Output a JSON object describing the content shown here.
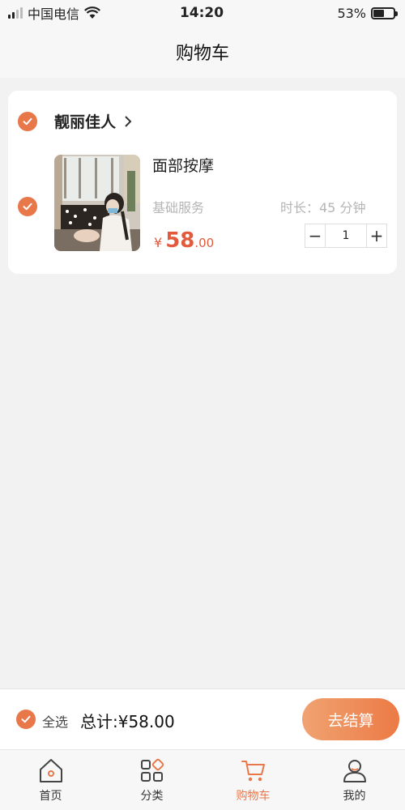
{
  "status_bar": {
    "carrier": "中国电信",
    "time": "14:20",
    "battery_percent": "53%",
    "battery_level": 0.53
  },
  "nav": {
    "title": "购物车"
  },
  "cart": {
    "shop_name": "靓丽佳人",
    "item": {
      "name": "面部按摩",
      "type": "基础服务",
      "duration": "时长：45 分钟",
      "currency": "¥",
      "price_int": "58",
      "price_dec": ".00",
      "quantity": "1",
      "decrease_label": "−",
      "increase_label": "+"
    }
  },
  "checkout": {
    "select_all": "全选",
    "total": "总计:¥58.00",
    "button": "去结算"
  },
  "tabs": [
    {
      "label": "首页",
      "icon": "home-icon"
    },
    {
      "label": "分类",
      "icon": "category-icon"
    },
    {
      "label": "购物车",
      "icon": "cart-icon",
      "active": true
    },
    {
      "label": "我的",
      "icon": "profile-icon"
    }
  ],
  "colors": {
    "accent": "#e8774a",
    "price": "#e25a3b",
    "button_gradient": [
      "#f0a371",
      "#ec7a45"
    ]
  }
}
